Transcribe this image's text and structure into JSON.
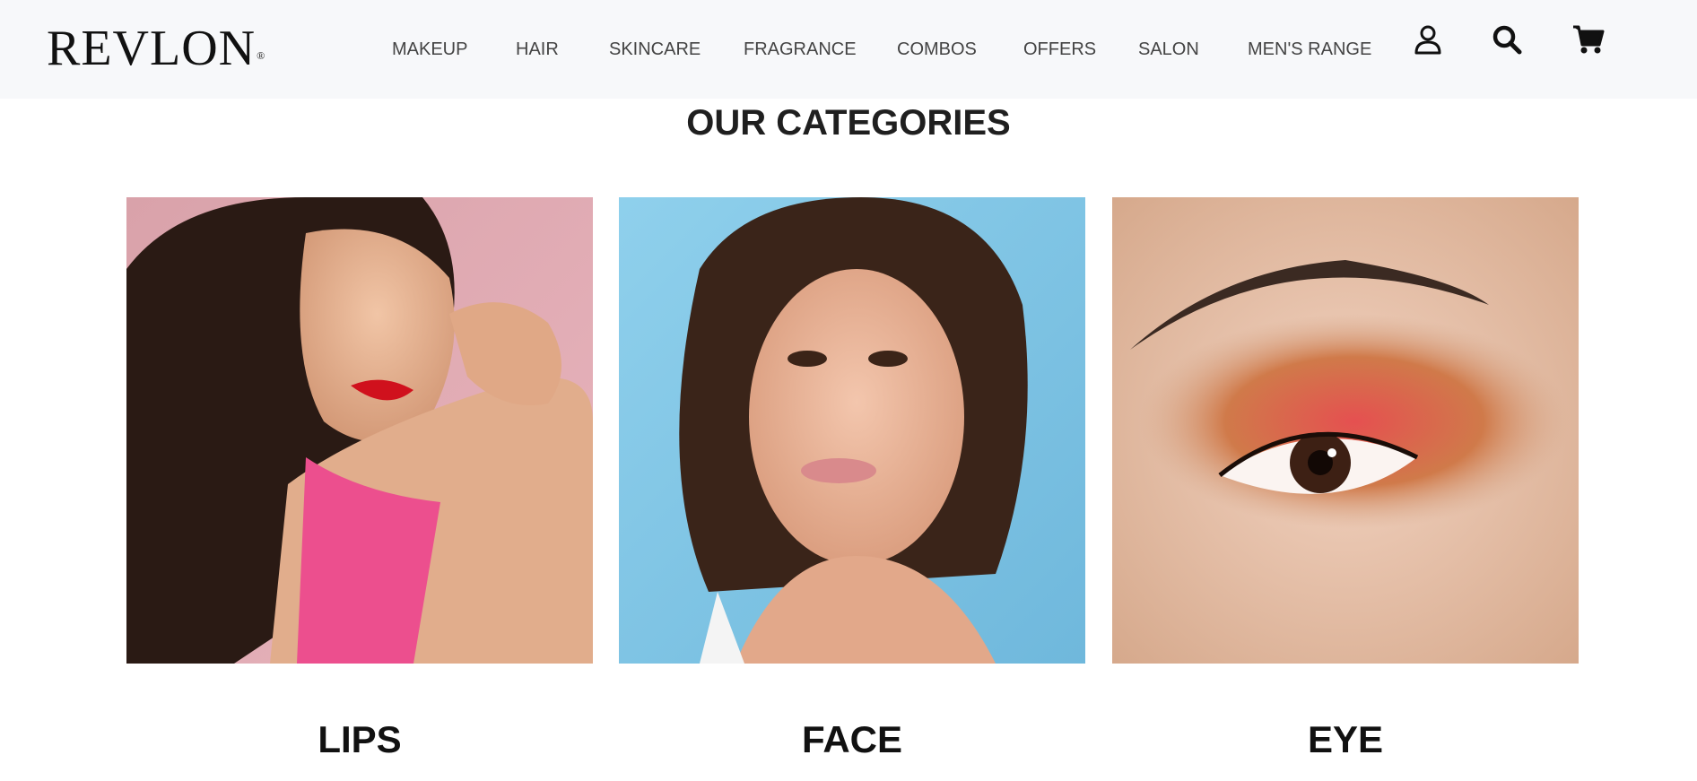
{
  "brand": {
    "logo_text": "REVLON",
    "registered_mark": "®"
  },
  "nav": {
    "items": [
      "MAKEUP",
      "HAIR",
      "SKINCARE",
      "FRAGRANCE",
      "COMBOS",
      "OFFERS",
      "SALON",
      "MEN'S RANGE"
    ],
    "icons": [
      "user-icon",
      "search-icon",
      "cart-icon"
    ]
  },
  "section": {
    "title": "OUR CATEGORIES"
  },
  "categories": [
    {
      "label": "LIPS",
      "image": "lips-model-photo"
    },
    {
      "label": "FACE",
      "image": "face-model-photo"
    },
    {
      "label": "EYE",
      "image": "eye-makeup-photo"
    }
  ],
  "colors": {
    "nav_bg": "#f7f8fa",
    "text": "#111111"
  }
}
